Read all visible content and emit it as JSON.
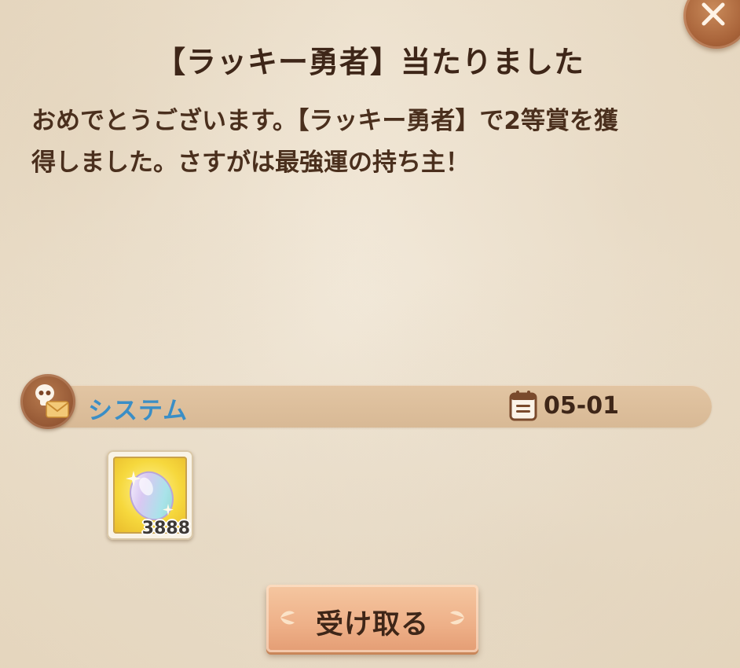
{
  "dialog": {
    "title": "【ラッキー勇者】当たりました",
    "message_line1": "おめでとうございます。【ラッキー勇者】で2等賞を獲",
    "message_line2": "得しました。さすがは最強運の持ち主！"
  },
  "sender": {
    "name": "システム",
    "date": "05-01",
    "icon": "skull-envelope-icon",
    "name_color": "#3a8ec6"
  },
  "reward": {
    "icon": "gem-icon",
    "count": "3888"
  },
  "actions": {
    "receive_label": "受け取る",
    "close_icon": "close-icon"
  }
}
